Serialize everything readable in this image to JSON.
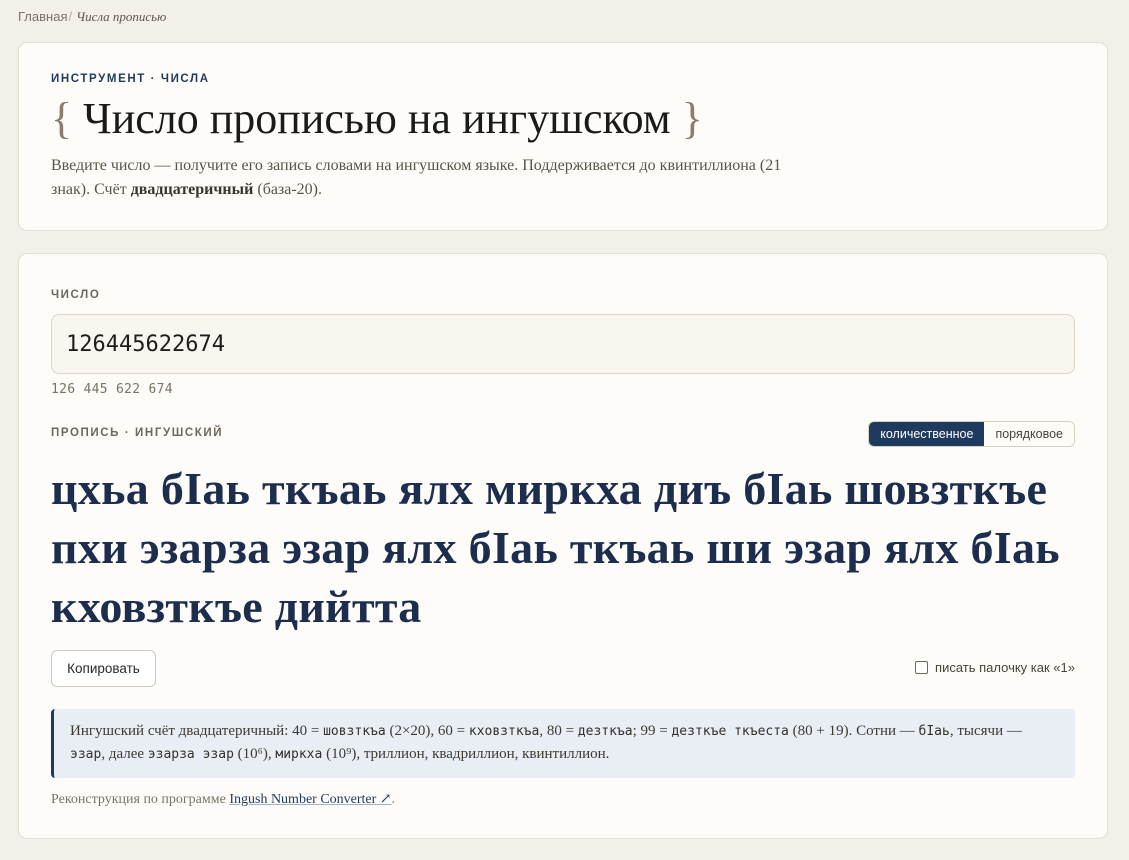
{
  "breadcrumb": {
    "home": "Главная",
    "separator": "/",
    "current": "Числа прописью"
  },
  "header": {
    "eyebrow": "ИНСТРУМЕНТ · ЧИСЛА",
    "brace_open": "{",
    "title": "Число прописью на ингушском",
    "brace_close": "}",
    "desc_part1": "Введите число — получите его запись словами на ингушском языке. Поддерживается до квинтиллиона (21 знак). Счёт ",
    "desc_bold": "двадцатеричный",
    "desc_part2": " (база-20)."
  },
  "number": {
    "label": "ЧИСЛО",
    "value": "126445622674",
    "groups": "126 445 622 674"
  },
  "spelling": {
    "label": "ПРОПИСЬ · ИНГУШСКИЙ",
    "mode_cardinal": "количественное",
    "mode_ordinal": "порядковое",
    "active_mode": "cardinal",
    "words": "цхьа бӀаь ткъаь ялх миркха диъ бӀаь шовзткъе пхи эзарза эзар ялх бӀаь ткъаь ши эзар ялх бӀаь кховзткъе дийтта"
  },
  "actions": {
    "copy": "Копировать",
    "stick_option": "писать палочку как «1»",
    "stick_checked": false
  },
  "note": {
    "t1": "Ингушский счёт двадцатеричный: 40 = ",
    "c1": "шовзткъа",
    "t2": " (2×20), 60 = ",
    "c2": "кховзткъа",
    "t3": ", 80 = ",
    "c3": "дезткъа",
    "t4": "; 99 = ",
    "c4": "дезткъе ткъеста",
    "t5": " (80 + 19). Сотни — ",
    "c5": "бӀаь",
    "t6": ", тысячи — ",
    "c6": "эзар",
    "t7": ", далее ",
    "c7": "эзарза эзар",
    "t8": " (10⁶), ",
    "c8": "миркха",
    "t9": " (10⁹), триллион, квадриллион, квинтиллион."
  },
  "credit": {
    "prefix": "Реконструкция по программе ",
    "link": "Ingush Number Converter ↗",
    "suffix": "."
  },
  "colors": {
    "accent": "#1f3a5f",
    "words": "#1c2d4d",
    "note_bg": "#e9eef5"
  }
}
